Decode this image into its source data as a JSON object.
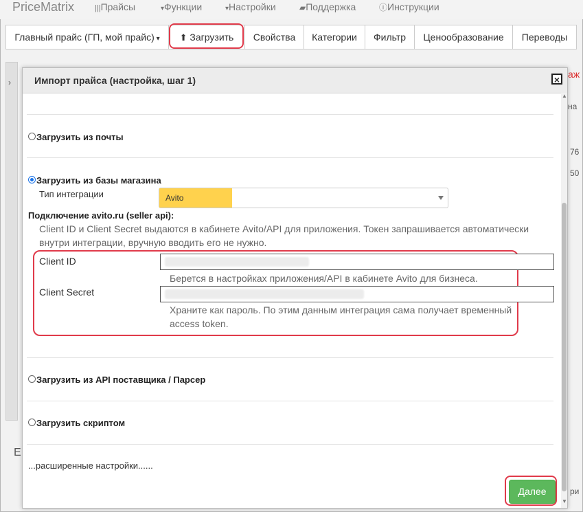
{
  "app": {
    "brand": "PriceMatrix"
  },
  "topmenu": [
    {
      "label": "Прайсы",
      "icon": "barcode-icon"
    },
    {
      "label": "Функции",
      "icon": "caret-down-icon"
    },
    {
      "label": "Настройки",
      "icon": "caret-down-icon"
    },
    {
      "label": "Поддержка",
      "icon": "chat-icon"
    },
    {
      "label": "Инструкции",
      "icon": "info-icon"
    }
  ],
  "toolbar": {
    "price_selector": "Главный прайс (ГП, мой прайс)",
    "upload": "Загрузить",
    "properties": "Свойства",
    "categories": "Категории",
    "filter": "Фильтр",
    "pricing": "Ценообразование",
    "translations": "Переводы"
  },
  "background": {
    "r1": "аж",
    "r2": "на",
    "r3": "76",
    "r4": "50",
    "r5": "ри",
    "left_letter": "E"
  },
  "modal": {
    "title": "Импорт прайса (настройка, шаг 1)",
    "close": "×",
    "opt_mail": "Загрузить из почты",
    "opt_shop": "Загрузить из базы магазина",
    "integration_label": "Тип интеграции",
    "integration_value": "Avito",
    "conn_title": "Подключение avito.ru (seller api):",
    "conn_hint": "Client ID и Client Secret выдаются в кабинете Avito/API для приложения. Токен запрашивается автоматически внутри интеграции, вручную вводить его не нужно.",
    "client_id_label": "Client ID",
    "client_id_hint": "Берется в настройках приложения/API в кабинете Avito для бизнеса.",
    "client_secret_label": "Client Secret",
    "client_secret_hint": "Храните как пароль. По этим данным интеграция сама получает временный access token.",
    "opt_api": "Загрузить из API поставщика / Парсер",
    "opt_script": "Загрузить скриптом",
    "advanced": "...расширенные настройки......",
    "next": "Далее"
  },
  "colors": {
    "accent_red": "#e03a4a",
    "highlight": "#ffd24d",
    "next_green": "#5cb85c"
  }
}
